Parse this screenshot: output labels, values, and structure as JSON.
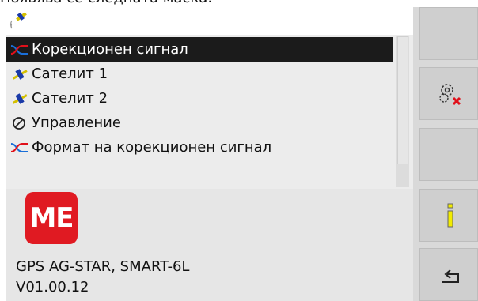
{
  "header": {
    "caption": "Появява се следната маска:",
    "satellite_icon": "gps-satellite-icon"
  },
  "menu": {
    "items": [
      {
        "label": "Корекционен сигнал",
        "icon": "correction-signal-icon",
        "selected": true
      },
      {
        "label": "Сателит 1",
        "icon": "satellite-icon",
        "selected": false
      },
      {
        "label": "Сателит 2",
        "icon": "satellite-icon",
        "selected": false
      },
      {
        "label": "Управление",
        "icon": "steering-icon",
        "selected": false
      },
      {
        "label": "Формат на корекционен сигнал",
        "icon": "correction-signal-icon",
        "selected": false
      }
    ]
  },
  "device": {
    "logo_text": "ME",
    "name": "GPS AG-STAR, SMART-6L",
    "version": "V01.00.12"
  },
  "side_buttons": [
    {
      "name": "empty-softkey-1",
      "icon": ""
    },
    {
      "name": "settings-delete-button",
      "icon": "gear-delete-icon"
    },
    {
      "name": "empty-softkey-2",
      "icon": ""
    },
    {
      "name": "info-button",
      "icon": "info-icon"
    },
    {
      "name": "back-button",
      "icon": "back-arrow-icon"
    }
  ],
  "colors": {
    "brand_red": "#e01a22",
    "selection": "#1b1b1b",
    "info_yellow": "#f2ec00",
    "delete_red": "#e0101a",
    "satellite_blue": "#1a3aa8",
    "correction_blue": "#1a6fd8",
    "correction_red": "#e0101a"
  }
}
